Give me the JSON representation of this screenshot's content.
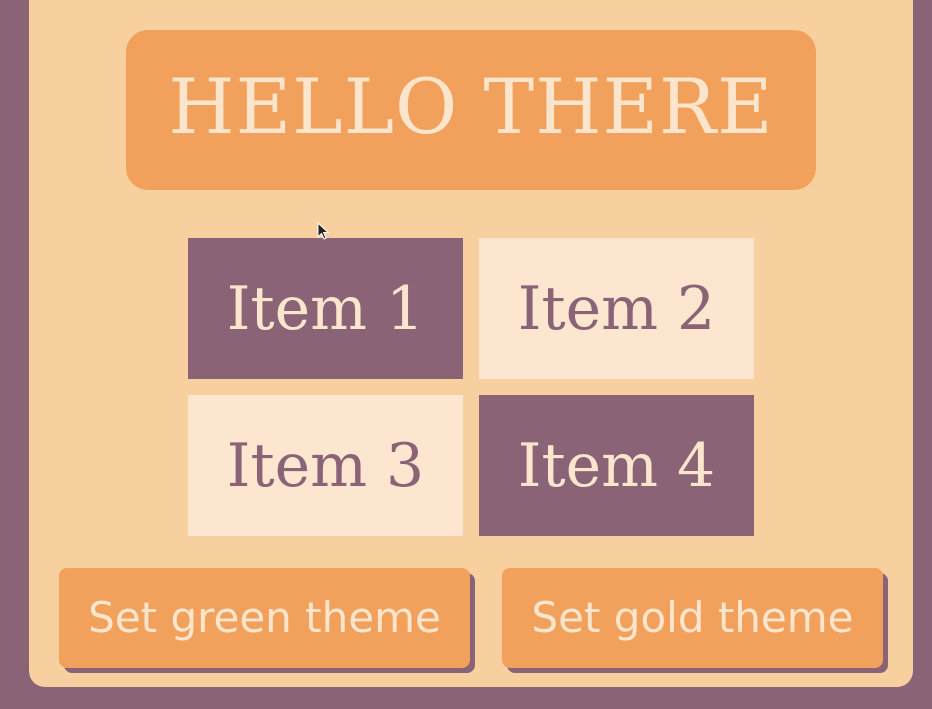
{
  "header": {
    "title": "HELLO THERE"
  },
  "grid": {
    "items": [
      {
        "label": "Item 1",
        "style": "dark"
      },
      {
        "label": "Item 2",
        "style": "light"
      },
      {
        "label": "Item 3",
        "style": "light"
      },
      {
        "label": "Item 4",
        "style": "dark"
      }
    ]
  },
  "buttons": {
    "green_theme": "Set green theme",
    "gold_theme": "Set gold theme"
  },
  "colors": {
    "background": "#8a6377",
    "panel": "#f8d09f",
    "accent": "#f2a15c",
    "light_cell": "#fce6cf",
    "dark_cell": "#8a6377",
    "text_light": "#fbe6cd"
  },
  "cursor": {
    "icon": "mouse-pointer-icon"
  }
}
